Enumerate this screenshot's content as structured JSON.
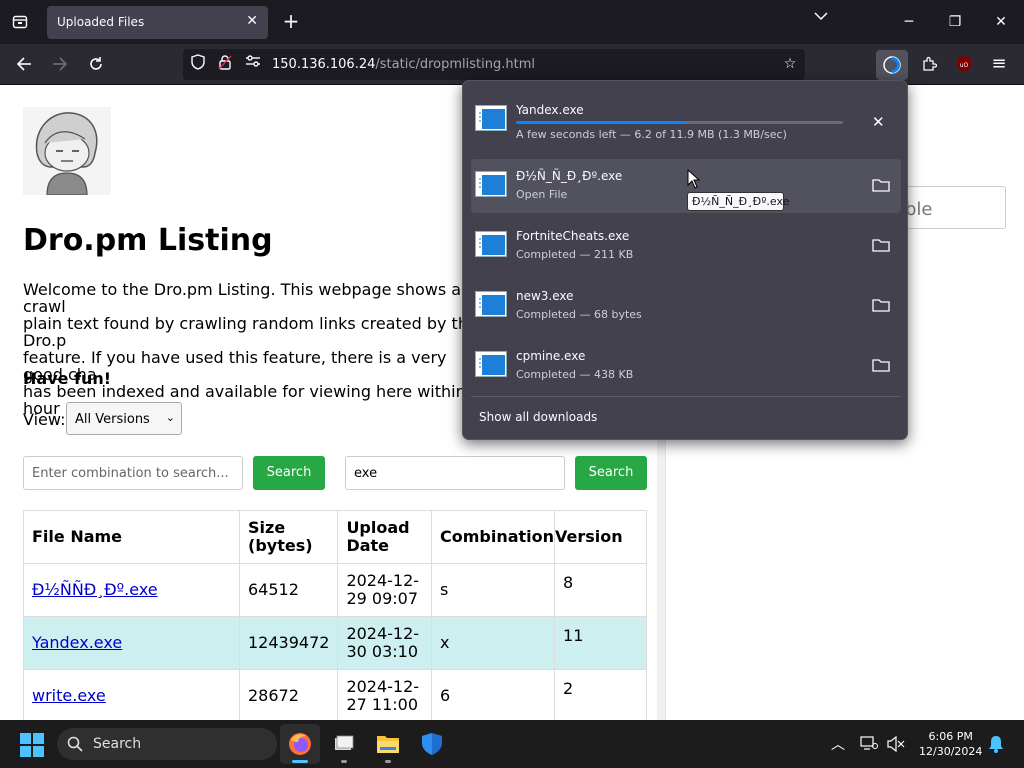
{
  "browser": {
    "tab_title": "Uploaded Files",
    "url_host": "150.136.106.24",
    "url_path": "/static/dropmlisting.html"
  },
  "page": {
    "title": "Dro.pm Listing",
    "intro": "Welcome to the Dro.pm Listing. This webpage shows all crawl\nplain text found by crawling random links created by the Dro.p\nfeature. If you have used this feature, there is a very good cha\nhas been indexed and available for viewing here within 6 hour",
    "have_fun": "Have fun!",
    "view_label": "View:",
    "view_selected": "All Versions",
    "search1": {
      "placeholder": "Enter combination to search...",
      "value": "",
      "button": "Search"
    },
    "search2": {
      "value": "exe",
      "button": "Search"
    },
    "right_input_text": "ble",
    "table": {
      "headers": [
        "File Name",
        "Size (bytes)",
        "Upload Date",
        "Combination",
        "Version"
      ],
      "rows": [
        {
          "name": "Ð½ÑÑÐ¸Ðº.exe",
          "size": "64512",
          "date": "2024-12-29 09:07",
          "combination": "s",
          "version": "8"
        },
        {
          "name": "Yandex.exe",
          "size": "12439472",
          "date": "2024-12-30 03:10",
          "combination": "x",
          "version": "11"
        },
        {
          "name": "write.exe",
          "size": "28672",
          "date": "2024-12-27 11:00",
          "combination": "6",
          "version": "2"
        }
      ]
    }
  },
  "downloads": {
    "items": [
      {
        "name": "Yandex.exe",
        "status": "A few seconds left — 6.2 of 11.9 MB (1.3 MB/sec)",
        "progress": 0.52
      },
      {
        "name": "Ð½Ñ_Ñ_Ð¸Ðº.exe",
        "status": "Open File"
      },
      {
        "name": "FortniteCheats.exe",
        "status": "Completed — 211 KB"
      },
      {
        "name": "new3.exe",
        "status": "Completed — 68 bytes"
      },
      {
        "name": "cpmine.exe",
        "status": "Completed — 438 KB"
      }
    ],
    "show_all": "Show all downloads",
    "tooltip": "Ð½Ñ_Ñ_Ð¸Ðº.exe"
  },
  "taskbar": {
    "search_label": "Search",
    "time": "6:06 PM",
    "date": "12/30/2024"
  },
  "colors": {
    "accent": "#0a84ff",
    "search_button": "#28a745",
    "highlight_row": "#cdeff0"
  }
}
